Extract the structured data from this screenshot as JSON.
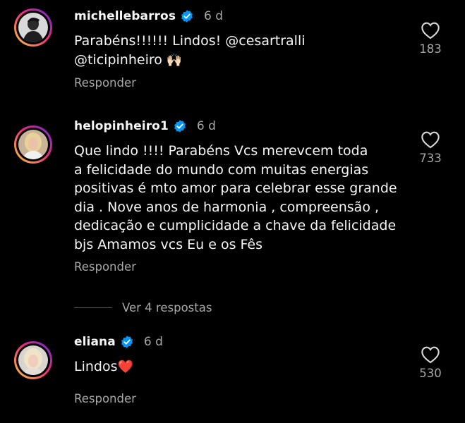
{
  "comments": [
    {
      "username": "michellebarros",
      "time": "6 d",
      "text": "Parabéns!!!!!! Lindos! @cesartralli\n@ticipinheiro",
      "emoji": "🙌🏻",
      "reply_label": "Responder",
      "likes": "183",
      "avatar_icon": "avatar-photo"
    },
    {
      "username": "helopinheiro1",
      "time": "6 d",
      "text": "Que lindo !!!! Parabéns  Vcs merevcem toda\na felicidade do mundo com muitas energias\npositivas é mto amor para celebrar esse grande\ndia . Nove anos de harmonia , compreensão ,\ndedicação e cumplicidade a chave da felicidade\nbjs Amamos vcs Eu e os Fês",
      "reply_label": "Responder",
      "likes": "733",
      "avatar_icon": "avatar-photo"
    },
    {
      "username": "eliana",
      "time": "6 d",
      "text": "Lindos",
      "emoji": "❤️",
      "reply_label": "Responder",
      "likes": "530",
      "avatar_icon": "avatar-photo"
    }
  ],
  "view_replies": "Ver 4 respostas",
  "colors": {
    "background": "#000000",
    "text": "#f5f5f5",
    "muted": "#a8a8a8",
    "verified": "#0095f6",
    "ring_start": "#f9ce34",
    "ring_end": "#6228d7"
  }
}
